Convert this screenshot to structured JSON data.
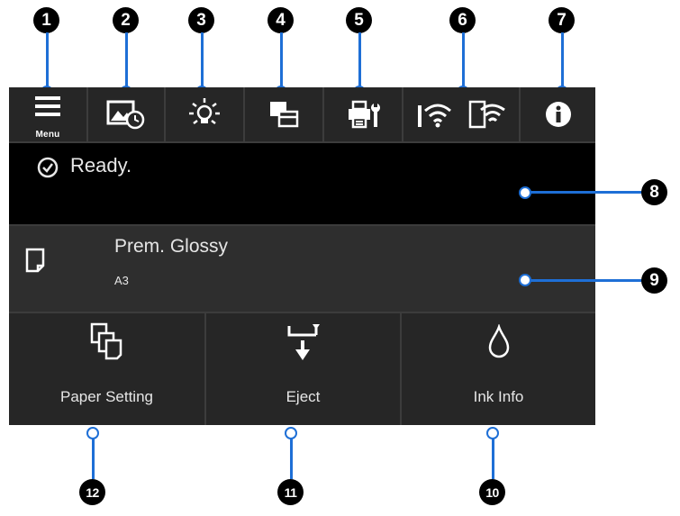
{
  "markers": [
    "1",
    "2",
    "3",
    "4",
    "5",
    "6",
    "7",
    "8",
    "9",
    "10",
    "11",
    "12"
  ],
  "toolbar": {
    "menu_label": "Menu"
  },
  "status": {
    "text": "Ready."
  },
  "paper": {
    "type": "Prem. Glossy",
    "size": "A3"
  },
  "buttons": {
    "paper_setting": "Paper Setting",
    "eject": "Eject",
    "ink_info": "Ink Info"
  },
  "colors": {
    "leader": "#1e6fd6",
    "panel_bg": "#262626",
    "status_bg": "#000000"
  }
}
